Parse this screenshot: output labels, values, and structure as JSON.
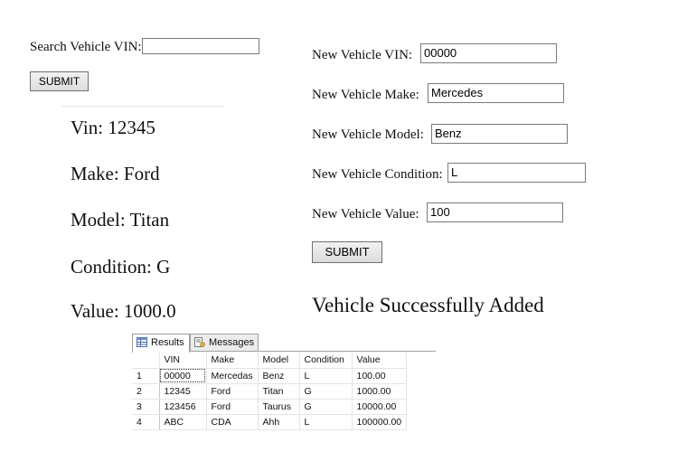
{
  "search": {
    "label": "Search Vehicle VIN:",
    "value": "",
    "submit_label": "SUBMIT"
  },
  "vehicle_details": {
    "vin": "Vin: 12345",
    "make": "Make: Ford",
    "model": "Model: Titan",
    "condition": "Condition: G",
    "value": "Value: 1000.0"
  },
  "new_vehicle": {
    "vin_label": "New Vehicle VIN:",
    "vin_value": "00000",
    "make_label": "New Vehicle Make:",
    "make_value": "Mercedes",
    "model_label": "New Vehicle Model:",
    "model_value": "Benz",
    "condition_label": "New Vehicle Condition:",
    "condition_value": "L",
    "value_label": "New Vehicle Value:",
    "value_value": "100",
    "submit_label": "SUBMIT",
    "status_message": "Vehicle Successfully Added"
  },
  "results_panel": {
    "tabs": [
      {
        "label": "Results",
        "icon": "grid-icon"
      },
      {
        "label": "Messages",
        "icon": "messages-icon"
      }
    ],
    "columns": [
      "VIN",
      "Make",
      "Model",
      "Condition",
      "Value"
    ],
    "rows": [
      {
        "num": "1",
        "cells": [
          "00000",
          "Mercedas",
          "Benz",
          "L",
          "100.00"
        ]
      },
      {
        "num": "2",
        "cells": [
          "12345",
          "Ford",
          "Titan",
          "G",
          "1000.00"
        ]
      },
      {
        "num": "3",
        "cells": [
          "123456",
          "Ford",
          "Taurus",
          "G",
          "10000.00"
        ]
      },
      {
        "num": "4",
        "cells": [
          "ABC",
          "CDA",
          "Ahh",
          "L",
          "100000.00"
        ]
      }
    ]
  }
}
